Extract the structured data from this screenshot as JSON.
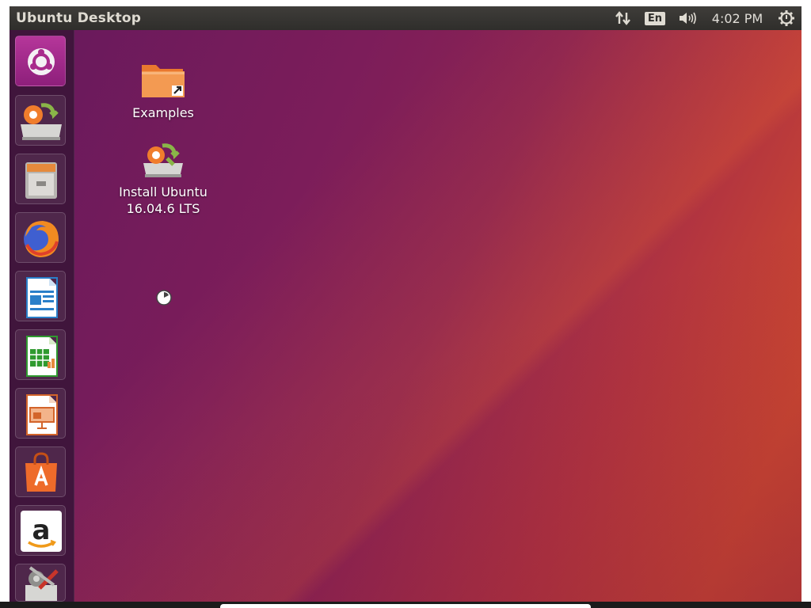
{
  "topbar": {
    "title": "Ubuntu Desktop",
    "language": "En",
    "time": "4:02 PM"
  },
  "launcher": {
    "items": [
      {
        "name": "Search your computer"
      },
      {
        "name": "Install Ubuntu 16.04.6 LTS"
      },
      {
        "name": "Files"
      },
      {
        "name": "Firefox Web Browser"
      },
      {
        "name": "LibreOffice Writer"
      },
      {
        "name": "LibreOffice Calc"
      },
      {
        "name": "LibreOffice Impress"
      },
      {
        "name": "Ubuntu Software"
      },
      {
        "name": "Amazon"
      },
      {
        "name": "System Settings"
      }
    ]
  },
  "desktop": {
    "icons": [
      {
        "label": "Examples"
      },
      {
        "label_line1": "Install Ubuntu",
        "label_line2": "16.04.6 LTS"
      }
    ]
  },
  "colors": {
    "topbar": "#2f2e2b",
    "launcher": "#3a1538",
    "accent_orange": "#e95420",
    "aubergine": "#77216f"
  }
}
